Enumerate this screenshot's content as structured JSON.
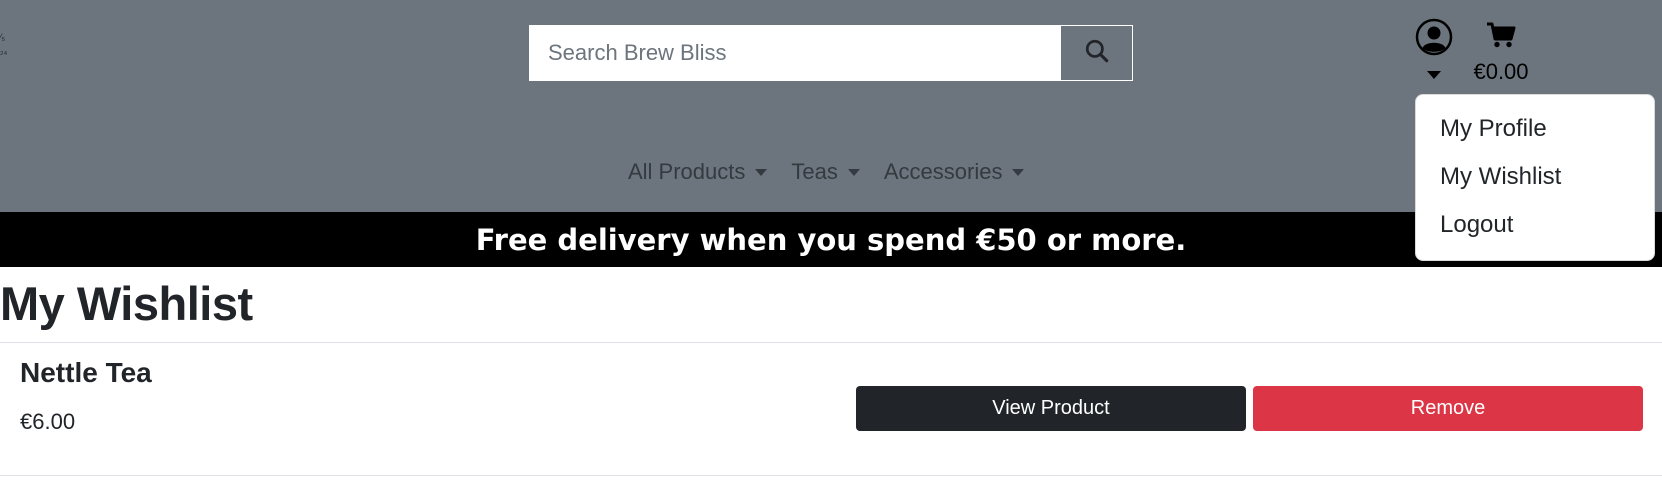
{
  "header": {
    "logo_fragment": "⁄₅ ₂₄",
    "search": {
      "placeholder": "Search Brew Bliss",
      "value": ""
    },
    "account": {
      "icon": "user-circle-icon"
    },
    "cart": {
      "icon": "shopping-cart-icon",
      "total": "€0.00"
    },
    "account_menu": {
      "items": [
        {
          "label": "My Profile"
        },
        {
          "label": "My Wishlist"
        },
        {
          "label": "Logout"
        }
      ]
    },
    "nav": {
      "items": [
        {
          "label": "All Products"
        },
        {
          "label": "Teas"
        },
        {
          "label": "Accessories"
        }
      ]
    },
    "colors": {
      "header_bg": "#6c757d",
      "banner_bg": "#000000"
    }
  },
  "banner": {
    "text": "Free delivery when you spend €50 or more."
  },
  "main": {
    "title": "My Wishlist",
    "items": [
      {
        "name": "Nettle Tea",
        "price": "€6.00",
        "view_label": "View Product",
        "remove_label": "Remove"
      }
    ],
    "colors": {
      "view_button": "#212529",
      "remove_button": "#dc3545"
    }
  }
}
